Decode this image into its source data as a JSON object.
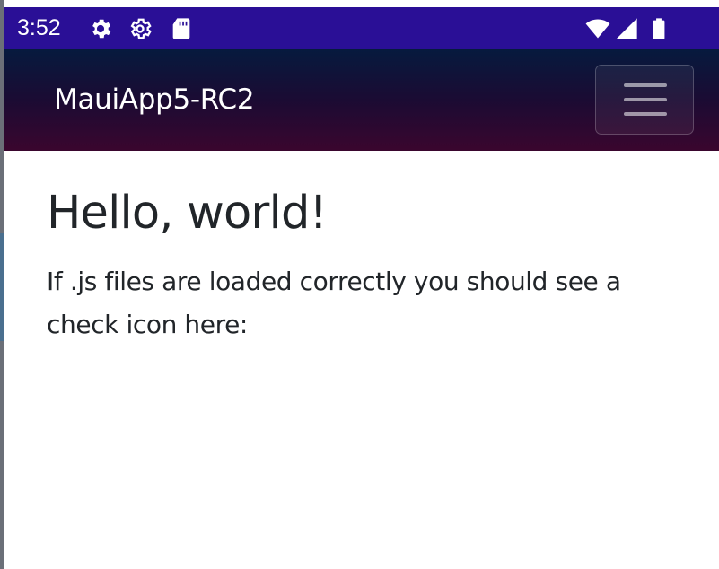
{
  "status_bar": {
    "time": "3:52",
    "background_color": "#2a0f96",
    "left_icons": [
      "gear-icon",
      "settings-outline-icon",
      "sd-card-icon"
    ],
    "right_icons": [
      "wifi-icon",
      "signal-icon",
      "battery-icon"
    ]
  },
  "app_bar": {
    "title": "MauiApp5-RC2",
    "menu_icon": "hamburger-menu-icon"
  },
  "main": {
    "heading": "Hello, world!",
    "paragraph": "If .js files are loaded correctly you should see a check icon here:"
  }
}
